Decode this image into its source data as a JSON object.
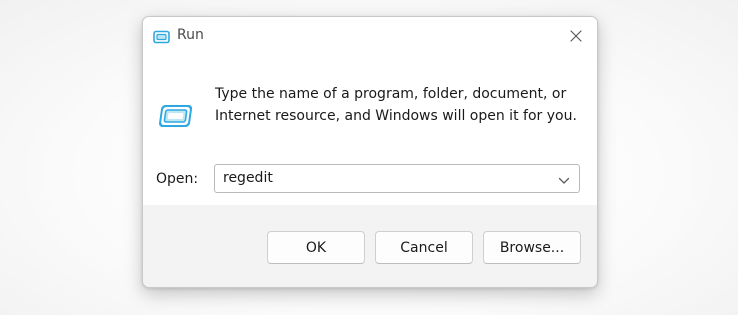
{
  "window": {
    "title": "Run",
    "title_icon": "run-icon",
    "close_icon": "close-icon"
  },
  "content": {
    "icon": "run-icon",
    "description_line1": "Type the name of a program, folder, document, or",
    "description_line2": "Internet resource, and Windows will open it for you."
  },
  "open_field": {
    "label": "Open:",
    "value": "regedit",
    "dropdown_icon": "chevron-down-icon"
  },
  "buttons": {
    "ok": "OK",
    "cancel": "Cancel",
    "browse": "Browse..."
  },
  "colors": {
    "icon_accent": "#2ea8e0",
    "icon_light": "#bfe6f7"
  }
}
